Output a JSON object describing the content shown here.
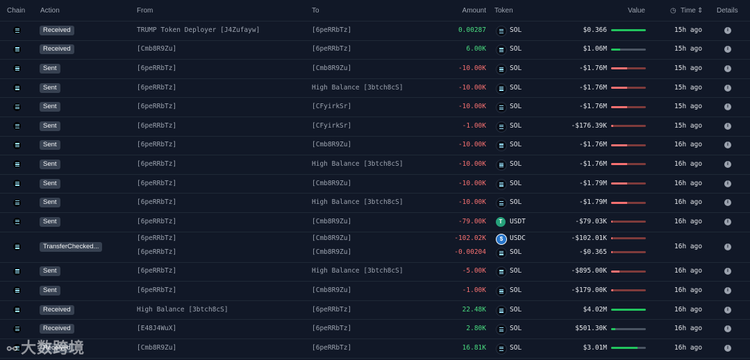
{
  "headers": {
    "chain": "Chain",
    "action": "Action",
    "from": "From",
    "to": "To",
    "amount": "Amount",
    "token": "Token",
    "value": "Value",
    "time": "Time",
    "details": "Details"
  },
  "icons": {
    "time_header": "clock-icon",
    "sort": "sort-icon",
    "chain": "solana-icon",
    "details": "info-icon"
  },
  "colors": {
    "background": "#111827",
    "positive": "#4ade80",
    "negative": "#f87171",
    "badge": "#374151"
  },
  "rows": [
    {
      "action": "Received",
      "from": "TRUMP Token Deployer [J4Zufayw]",
      "to": "[6peRRbTz]",
      "amount": "0.00287",
      "sign": "pos",
      "token": "SOL",
      "value": "$0.366",
      "bar": 1.0,
      "time": "15h ago"
    },
    {
      "action": "Received",
      "from": "[Cmb8R9Zu]",
      "to": "[6peRRbTz]",
      "amount": "6.00K",
      "sign": "pos",
      "token": "SOL",
      "value": "$1.06M",
      "bar": 0.25,
      "time": "15h ago"
    },
    {
      "action": "Sent",
      "from": "[6peRRbTz]",
      "to": "[Cmb8R9Zu]",
      "amount": "-10.00K",
      "sign": "neg",
      "token": "SOL",
      "value": "-$1.76M",
      "bar": 0.45,
      "time": "15h ago"
    },
    {
      "action": "Sent",
      "from": "[6peRRbTz]",
      "to": "High Balance [3btch8cS]",
      "amount": "-10.00K",
      "sign": "neg",
      "token": "SOL",
      "value": "-$1.76M",
      "bar": 0.45,
      "time": "15h ago"
    },
    {
      "action": "Sent",
      "from": "[6peRRbTz]",
      "to": "[CFyirkSr]",
      "amount": "-10.00K",
      "sign": "neg",
      "token": "SOL",
      "value": "-$1.76M",
      "bar": 0.45,
      "time": "15h ago"
    },
    {
      "action": "Sent",
      "from": "[6peRRbTz]",
      "to": "[CFyirkSr]",
      "amount": "-1.00K",
      "sign": "neg",
      "token": "SOL",
      "value": "-$176.39K",
      "bar": 0.05,
      "time": "15h ago"
    },
    {
      "action": "Sent",
      "from": "[6peRRbTz]",
      "to": "[Cmb8R9Zu]",
      "amount": "-10.00K",
      "sign": "neg",
      "token": "SOL",
      "value": "-$1.76M",
      "bar": 0.45,
      "time": "16h ago"
    },
    {
      "action": "Sent",
      "from": "[6peRRbTz]",
      "to": "High Balance [3btch8cS]",
      "amount": "-10.00K",
      "sign": "neg",
      "token": "SOL",
      "value": "-$1.76M",
      "bar": 0.45,
      "time": "16h ago"
    },
    {
      "action": "Sent",
      "from": "[6peRRbTz]",
      "to": "[Cmb8R9Zu]",
      "amount": "-10.00K",
      "sign": "neg",
      "token": "SOL",
      "value": "-$1.79M",
      "bar": 0.46,
      "time": "16h ago"
    },
    {
      "action": "Sent",
      "from": "[6peRRbTz]",
      "to": "High Balance [3btch8cS]",
      "amount": "-10.00K",
      "sign": "neg",
      "token": "SOL",
      "value": "-$1.79M",
      "bar": 0.46,
      "time": "16h ago"
    },
    {
      "action": "Sent",
      "from": "[6peRRbTz]",
      "to": "[Cmb8R9Zu]",
      "amount": "-79.00K",
      "sign": "neg",
      "token": "USDT",
      "value": "-$79.03K",
      "bar": 0.02,
      "time": "16h ago"
    },
    {
      "action": "TransferChecked...",
      "multi": true,
      "time": "16h ago",
      "subs": [
        {
          "from": "[6peRRbTz]",
          "to": "[Cmb8R9Zu]",
          "amount": "-102.02K",
          "token": "USDC",
          "value": "-$102.01K",
          "bar": 0.03
        },
        {
          "from": "[6peRRbTz]",
          "to": "[Cmb8R9Zu]",
          "amount": "-0.00204",
          "token": "SOL",
          "value": "-$0.365",
          "bar": 0.0
        }
      ]
    },
    {
      "action": "Sent",
      "from": "[6peRRbTz]",
      "to": "High Balance [3btch8cS]",
      "amount": "-5.00K",
      "sign": "neg",
      "token": "SOL",
      "value": "-$895.00K",
      "bar": 0.23,
      "time": "16h ago"
    },
    {
      "action": "Sent",
      "from": "[6peRRbTz]",
      "to": "[Cmb8R9Zu]",
      "amount": "-1.00K",
      "sign": "neg",
      "token": "SOL",
      "value": "-$179.00K",
      "bar": 0.05,
      "time": "16h ago"
    },
    {
      "action": "Received",
      "from": "High Balance [3btch8cS]",
      "to": "[6peRRbTz]",
      "amount": "22.48K",
      "sign": "pos",
      "token": "SOL",
      "value": "$4.02M",
      "bar": 1.0,
      "time": "16h ago"
    },
    {
      "action": "Received",
      "from": "[E48J4WuX]",
      "to": "[6peRRbTz]",
      "amount": "2.80K",
      "sign": "pos",
      "token": "SOL",
      "value": "$501.30K",
      "bar": 0.12,
      "time": "16h ago"
    },
    {
      "action": "Received",
      "from": "[Cmb8R9Zu]",
      "to": "[6peRRbTz]",
      "amount": "16.81K",
      "sign": "pos",
      "token": "SOL",
      "value": "$3.01M",
      "bar": 0.75,
      "time": "16h ago"
    }
  ],
  "watermark": "大数跨境"
}
